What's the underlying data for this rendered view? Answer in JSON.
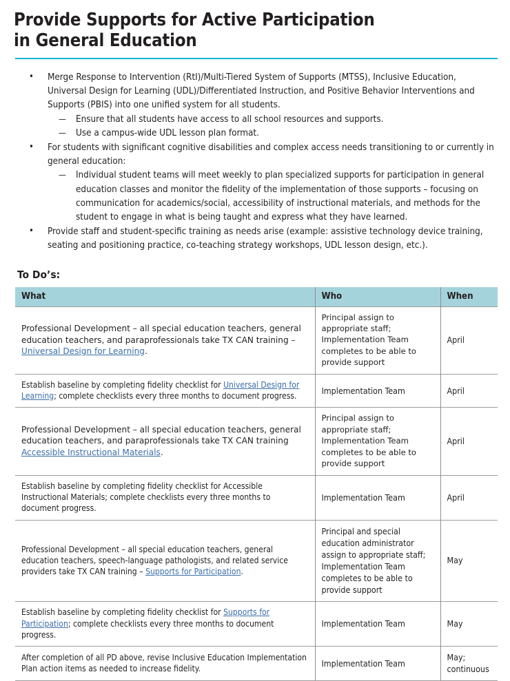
{
  "document": {
    "title_line1": "Provide Supports for Active Participation",
    "title_line2": "in General Education",
    "rule_color": "#0fb4c8",
    "link_color": "#3a6ea8",
    "header_fill": "#a5d3dc"
  },
  "bullets": [
    {
      "level": 1,
      "marker": "•",
      "text": "Merge Response to Intervention (RtI)/Multi-Tiered System of Supports (MTSS), Inclusive Education, Universal Design for Learning (UDL)/Differentiated Instruction, and Positive Behavior Interventions and Supports (PBIS) into one unified system for all students."
    },
    {
      "level": 2,
      "marker": "—",
      "text": "Ensure that all students have access to all school resources and supports."
    },
    {
      "level": 2,
      "marker": "—",
      "text": "Use a campus-wide UDL lesson plan format."
    },
    {
      "level": 1,
      "marker": "•",
      "text": "For students with significant cognitive disabilities and complex access needs transitioning to or currently in general education:"
    },
    {
      "level": 2,
      "marker": "—",
      "text": "Individual student teams will meet weekly to plan specialized supports for participation in general education classes and monitor the fidelity of the implementation of those supports – focusing on communication for academics/social, accessibility of instructional materials, and methods for the student to engage in what is being taught and express what they have learned."
    },
    {
      "level": 1,
      "marker": "•",
      "text": "Provide staff and student-specific training as needs arise (example: assistive technology device training, seating and positioning practice, co-teaching strategy workshops, UDL lesson design, etc.)."
    }
  ],
  "todo": {
    "heading": "To Do’s:",
    "columns": [
      "What",
      "Who",
      "When"
    ],
    "rows": [
      {
        "what_pre": "Professional Development – all special education teachers, general education teachers, and paraprofessionals take TX CAN training – ",
        "what_link": "Universal Design for Learning",
        "what_post": ".",
        "who": "Principal assign to appropriate staff; Implementation Team completes to be able to provide support",
        "when": "April",
        "style": "regular"
      },
      {
        "what_pre": "Establish baseline by completing fidelity checklist for ",
        "what_link": "Universal Design for Learning",
        "what_post": "; complete checklists every three months to document progress.",
        "who": "Implementation Team",
        "when": "April",
        "style": "condensed"
      },
      {
        "what_pre": "Professional Development – all special education teachers, general education teachers, and paraprofessionals take TX CAN training ",
        "what_link": "Accessible Instructional Materials",
        "what_post": ".",
        "who": "Principal assign to appropriate staff; Implementation Team completes to be able to provide support",
        "when": "April",
        "style": "regular"
      },
      {
        "what_pre": "Establish baseline by completing fidelity checklist for Accessible Instructional Materials; complete checklists every three months to document progress.",
        "what_link": "",
        "what_post": "",
        "who": "Implementation Team",
        "when": "April",
        "style": "condensed"
      },
      {
        "what_pre": "Professional Development – all special education teachers, general education teachers, speech-language pathologists, and related service providers take TX CAN training – ",
        "what_link": "Supports for Participation",
        "what_post": ".",
        "who": "Principal and special education administrator assign to appropriate staff; Implementation Team completes to be able to provide support",
        "when": "May",
        "style": "condensed"
      },
      {
        "what_pre": "Establish baseline by completing fidelity checklist for ",
        "what_link": "Supports for Participation",
        "what_post": "; complete checklists every three months to document progress.",
        "who": "Implementation Team",
        "when": "May",
        "style": "condensed"
      },
      {
        "what_pre": "After completion of all PD above, revise Inclusive Education Implementation Plan action items as needed to increase fidelity.",
        "what_link": "",
        "what_post": "",
        "who": "Implementation Team",
        "when": "May; continuous",
        "style": "condensed"
      }
    ]
  }
}
